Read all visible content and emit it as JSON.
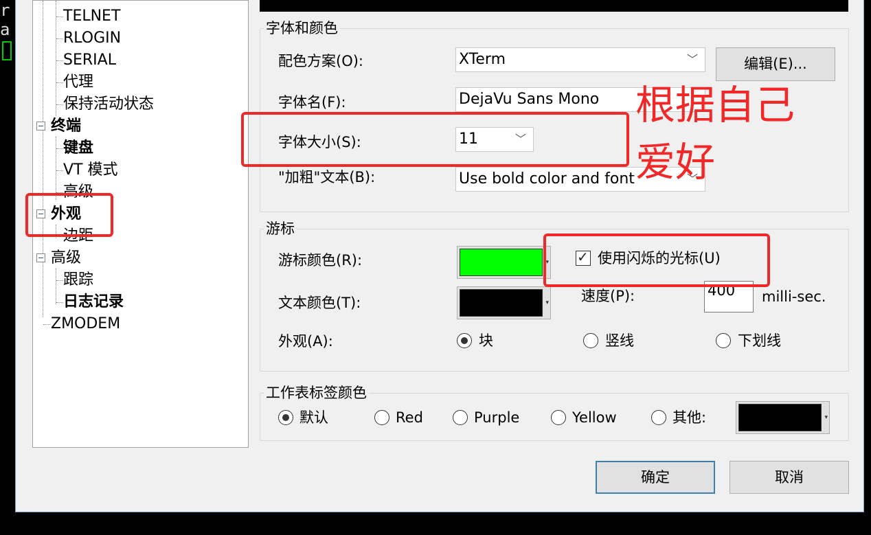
{
  "terminal": {
    "line1": "r",
    "line2": "a"
  },
  "tree": {
    "items": [
      {
        "label": "TELNET"
      },
      {
        "label": "RLOGIN"
      },
      {
        "label": "SERIAL"
      },
      {
        "label": "代理"
      },
      {
        "label": "保持活动状态"
      },
      {
        "label": "终端"
      },
      {
        "label": "键盘"
      },
      {
        "label": "VT 模式"
      },
      {
        "label": "高级"
      },
      {
        "label": "外观"
      },
      {
        "label": "边距"
      },
      {
        "label": "高级"
      },
      {
        "label": "跟踪"
      },
      {
        "label": "日志记录"
      },
      {
        "label": "ZMODEM"
      }
    ]
  },
  "font_group": {
    "title": "字体和颜色",
    "scheme_label": "配色方案(O):",
    "scheme_value": "XTerm",
    "edit_button": "编辑(E)...",
    "font_label": "字体名(F):",
    "font_value": "DejaVu Sans Mono",
    "size_label": "字体大小(S):",
    "size_value": "11",
    "bold_label": "\"加粗\"文本(B):",
    "bold_value": "Use bold color and font"
  },
  "cursor_group": {
    "title": "游标",
    "cursor_color_label": "游标颜色(R):",
    "text_color_label": "文本颜色(T):",
    "blink_label": "使用闪烁的光标(U)",
    "speed_label": "速度(P):",
    "speed_value": "400",
    "speed_unit": "milli-sec.",
    "shape_label": "外观(A):",
    "shape_block": "块",
    "shape_vline": "竖线",
    "shape_underline": "下划线"
  },
  "tab_group": {
    "title": "工作表标签颜色",
    "opt_default": "默认",
    "opt_red": "Red",
    "opt_purple": "Purple",
    "opt_yellow": "Yellow",
    "opt_other": "其他:"
  },
  "footer": {
    "ok": "确定",
    "cancel": "取消"
  },
  "annotation": {
    "line1": "根据自己",
    "line2": "爱好"
  },
  "colors": {
    "cursor_color": "#00ff00",
    "text_color": "#000000",
    "other_tab_color": "#000000",
    "annotation": "#f02828"
  }
}
